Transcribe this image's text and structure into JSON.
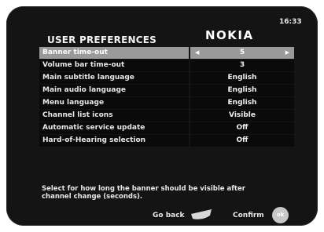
{
  "header": {
    "title": "USER PREFERENCES",
    "logo": "NOKIA",
    "time": "16:33"
  },
  "menu": {
    "selected_index": 0,
    "items": [
      {
        "label": "Banner time-out",
        "value": "5"
      },
      {
        "label": "Volume bar time-out",
        "value": "3"
      },
      {
        "label": "Main subtitle language",
        "value": "English"
      },
      {
        "label": "Main audio language",
        "value": "English"
      },
      {
        "label": "Menu language",
        "value": "English"
      },
      {
        "label": "Channel list icons",
        "value": "Visible"
      },
      {
        "label": "Automatic service update",
        "value": "Off"
      },
      {
        "label": "Hard-of-Hearing selection",
        "value": "Off"
      }
    ]
  },
  "icons": {
    "left_arrow": "◀",
    "right_arrow": "▶"
  },
  "help": {
    "line1": "Select for how long the banner should be visible after",
    "line2": "channel change (seconds)."
  },
  "footer": {
    "back_label": "Go back",
    "confirm_label": "Confirm",
    "ok_key": "ok"
  },
  "colors": {
    "background": "#141414",
    "selected_row": "#9a9a9a",
    "row": "#0a0a0a",
    "text": "#e8e8e8"
  }
}
